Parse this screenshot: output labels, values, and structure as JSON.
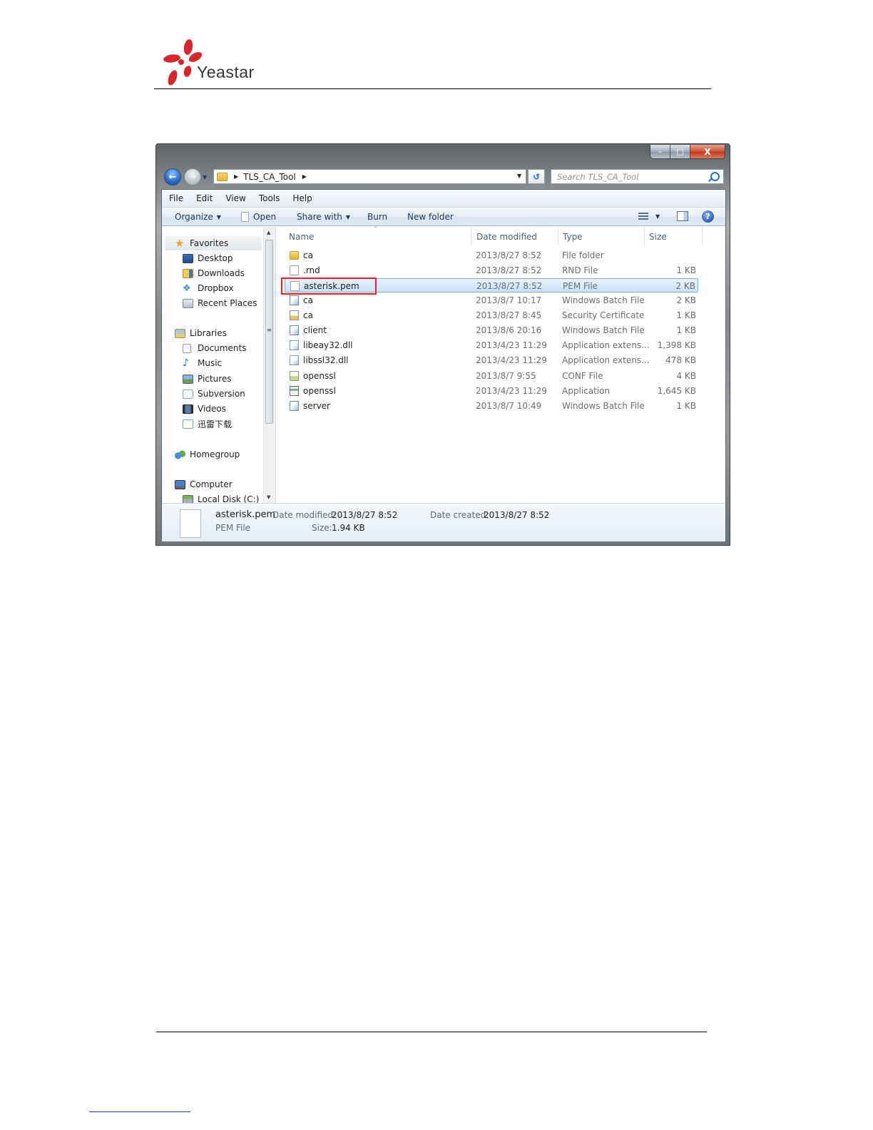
{
  "doc": {
    "brand": "Yeastar"
  },
  "window": {
    "breadcrumb": [
      "TLS_CA_Tool"
    ],
    "search_placeholder": "Search TLS_CA_Tool",
    "caption": {
      "minimize": "–",
      "maximize": "□",
      "close": "X"
    }
  },
  "menu": {
    "file": "File",
    "edit": "Edit",
    "view": "View",
    "tools": "Tools",
    "help": "Help"
  },
  "toolbar": {
    "organize": "Organize",
    "open": "Open",
    "share_with": "Share with",
    "burn": "Burn",
    "new_folder": "New folder"
  },
  "nav": {
    "favorites": "Favorites",
    "desktop": "Desktop",
    "downloads": "Downloads",
    "dropbox": "Dropbox",
    "recent_places": "Recent Places",
    "libraries": "Libraries",
    "documents": "Documents",
    "music": "Music",
    "pictures": "Pictures",
    "subversion": "Subversion",
    "videos": "Videos",
    "xunlei": "迅雷下载",
    "homegroup": "Homegroup",
    "computer": "Computer",
    "local_disk": "Local Disk (C:)"
  },
  "columns": {
    "name": "Name",
    "date": "Date modified",
    "type": "Type",
    "size": "Size"
  },
  "files": [
    {
      "name": "ca",
      "date": "2013/8/27 8:52",
      "type": "File folder",
      "size": "",
      "icon": "folder-icon"
    },
    {
      "name": ".rnd",
      "date": "2013/8/27 8:52",
      "type": "RND File",
      "size": "1 KB",
      "icon": "blank-file-icon"
    },
    {
      "name": "asterisk.pem",
      "date": "2013/8/27 8:52",
      "type": "PEM File",
      "size": "2 KB",
      "icon": "blank-file-icon",
      "selected": true
    },
    {
      "name": "ca",
      "date": "2013/8/7 10:17",
      "type": "Windows Batch File",
      "size": "2 KB",
      "icon": "batch-file-icon"
    },
    {
      "name": "ca",
      "date": "2013/8/27 8:45",
      "type": "Security Certificate",
      "size": "1 KB",
      "icon": "certificate-icon"
    },
    {
      "name": "client",
      "date": "2013/8/6 20:16",
      "type": "Windows Batch File",
      "size": "1 KB",
      "icon": "batch-file-icon"
    },
    {
      "name": "libeay32.dll",
      "date": "2013/4/23 11:29",
      "type": "Application extens...",
      "size": "1,398 KB",
      "icon": "dll-icon"
    },
    {
      "name": "libssl32.dll",
      "date": "2013/4/23 11:29",
      "type": "Application extens...",
      "size": "478 KB",
      "icon": "dll-icon"
    },
    {
      "name": "openssl",
      "date": "2013/8/7 9:55",
      "type": "CONF File",
      "size": "4 KB",
      "icon": "conf-file-icon"
    },
    {
      "name": "openssl",
      "date": "2013/4/23 11:29",
      "type": "Application",
      "size": "1,645 KB",
      "icon": "application-icon"
    },
    {
      "name": "server",
      "date": "2013/8/7 10:49",
      "type": "Windows Batch File",
      "size": "1 KB",
      "icon": "batch-file-icon"
    }
  ],
  "details": {
    "name": "asterisk.pem",
    "type": "PEM File",
    "modified_label": "Date modified:",
    "modified": "2013/8/27 8:52",
    "created_label": "Date created:",
    "created": "2013/8/27 8:52",
    "size_label": "Size:",
    "size": "1.94 KB"
  },
  "colors": {
    "highlight_box": "#e0202c",
    "selection": "#c9e1fa",
    "logo_red": "#d7262e"
  }
}
